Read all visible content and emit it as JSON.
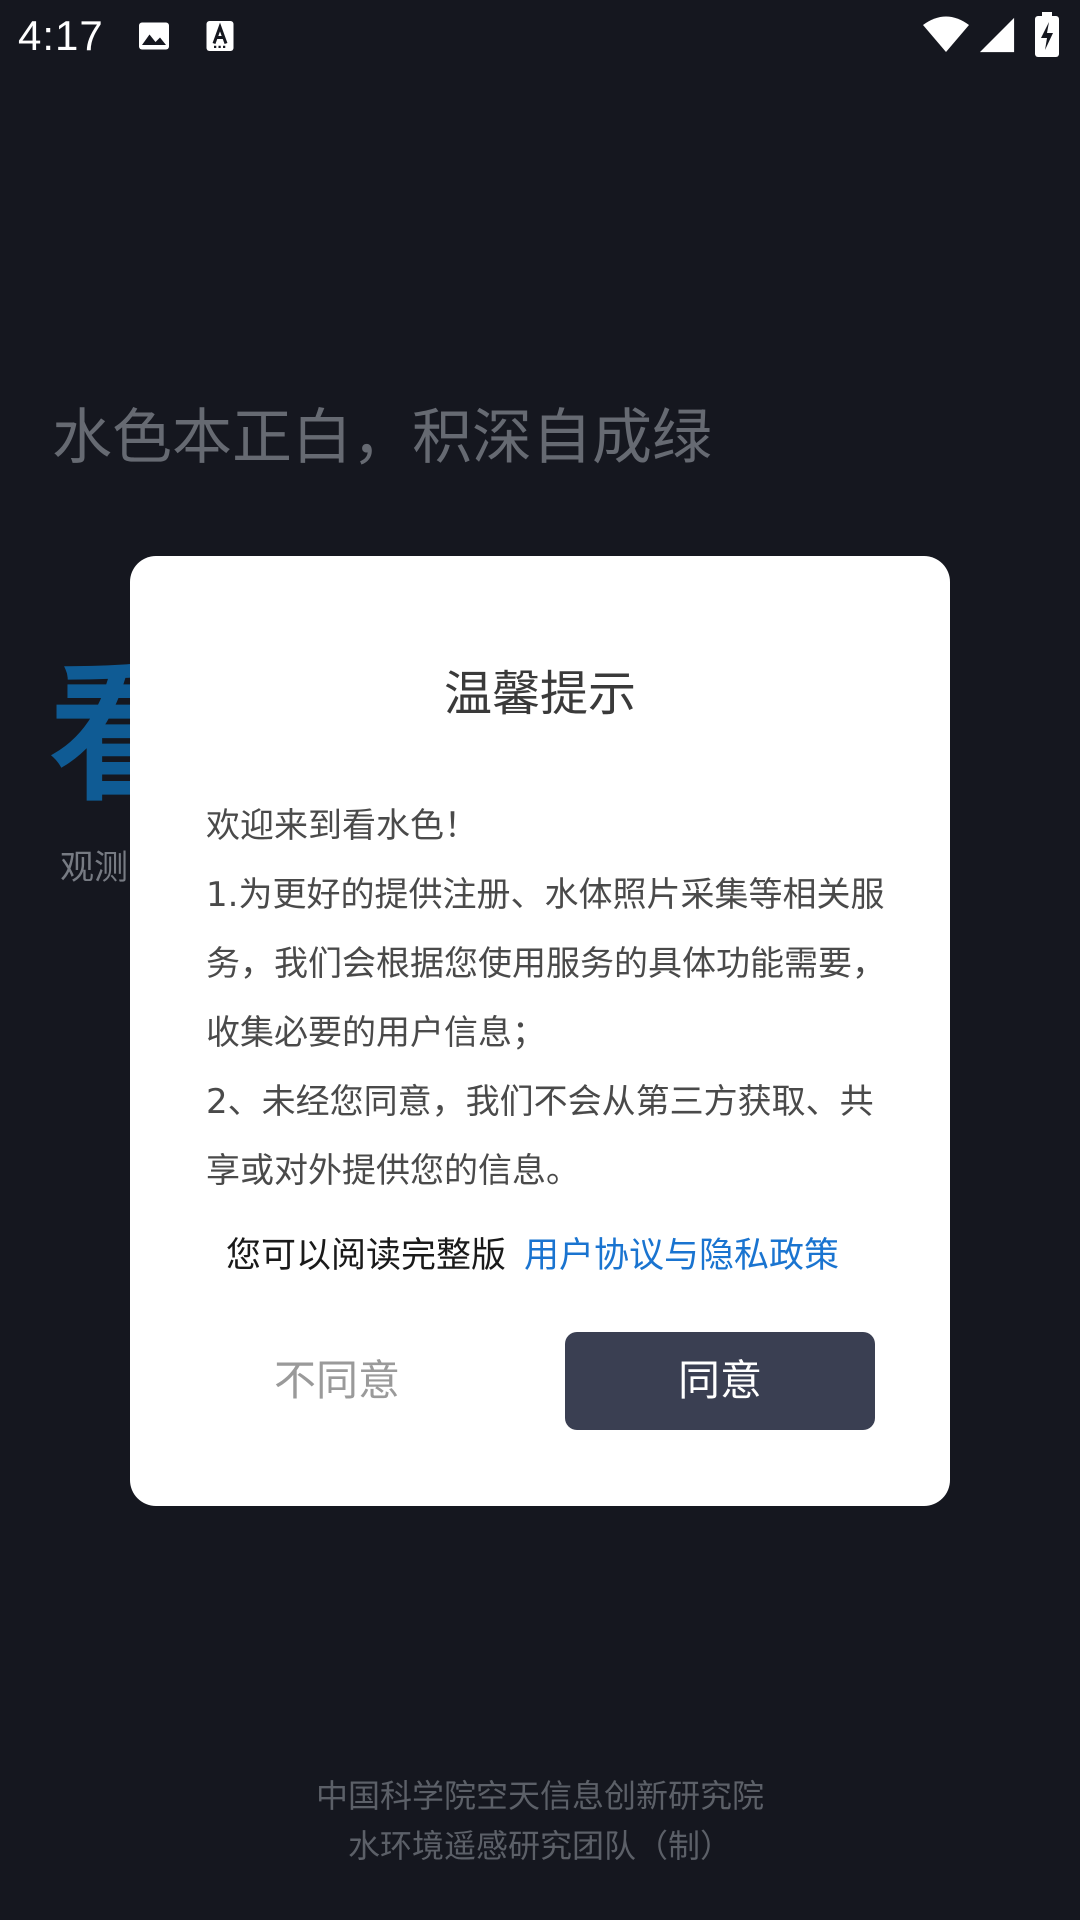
{
  "status_bar": {
    "time": "4:17",
    "icons": [
      "image-icon",
      "text-a-icon",
      "wifi-icon",
      "signal-icon",
      "battery-charging-icon"
    ]
  },
  "background": {
    "slogan": "水色本正白，积深自成绿",
    "brand_big": "看",
    "brand_sub": "观测",
    "footer_line1": "中国科学院空天信息创新研究院",
    "footer_line2": "水环境遥感研究团队（制）"
  },
  "dialog": {
    "title": "温馨提示",
    "body_lines": [
      "欢迎来到看水色！",
      "1.为更好的提供注册、水体照片采集等相关服务，我们会根据您使用服务的具体功能需要，收集必要的用户信息；",
      "2、未经您同意，我们不会从第三方获取、共享或对外提供您的信息。"
    ],
    "read_prefix": "您可以阅读完整版",
    "policy_link": "用户协议与隐私政策",
    "disagree_label": "不同意",
    "agree_label": "同意"
  },
  "colors": {
    "background": "#15171f",
    "brand": "#0f5b94",
    "link": "#1a74d0",
    "agree_button": "#3a3f52"
  }
}
